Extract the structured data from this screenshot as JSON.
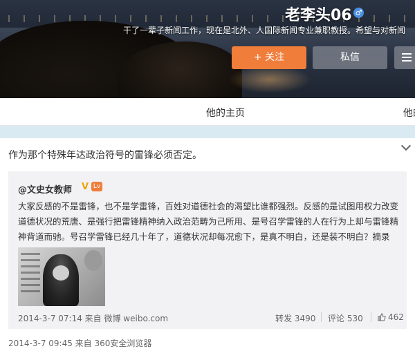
{
  "profile": {
    "name": "老李头06",
    "gender_icon": "male-icon",
    "bio": "干了一辈子新闻工作，现在是北外、人国际新闻专业兼职教授。希望与对新闻",
    "follow_label": "+ 关注",
    "message_label": "私信",
    "more_icon": "menu-icon"
  },
  "nav": {
    "tabs": [
      {
        "label": "他的主页"
      },
      {
        "label": "他的"
      }
    ]
  },
  "post": {
    "text": "作为那个特殊年达政治符号的雷锋必须否定。",
    "meta": "2014-3-7 09:45 来自 360安全浏览器",
    "repost": {
      "author": "@文史女教师",
      "verified_badge": "V",
      "level_badge": "Lv",
      "body_lines": [
        "大家反感的不是雷锋，也不是学雷锋，百姓对道德社会的渴望比谁都强烈。反感的是试图用权力改变",
        "道德状况的荒唐、是强行把雷锋精神纳入政治范畴为己所用、是号召学雷锋的人在行为上却与雷锋精",
        "神背道而驰。号召学雷锋已经几十年了，道德状况却每况愈下，是真不明白，还是装不明白？摘录"
      ],
      "meta": "2014-3-7 07:14 来自 微博 weibo.com",
      "repost_label": "转发 3490",
      "comment_label": "评论 530",
      "like_count": "462"
    }
  },
  "colors": {
    "follow_button": "#f07d3a",
    "separator": "#d9eaf2",
    "repost_bg": "#f2f2f5"
  }
}
